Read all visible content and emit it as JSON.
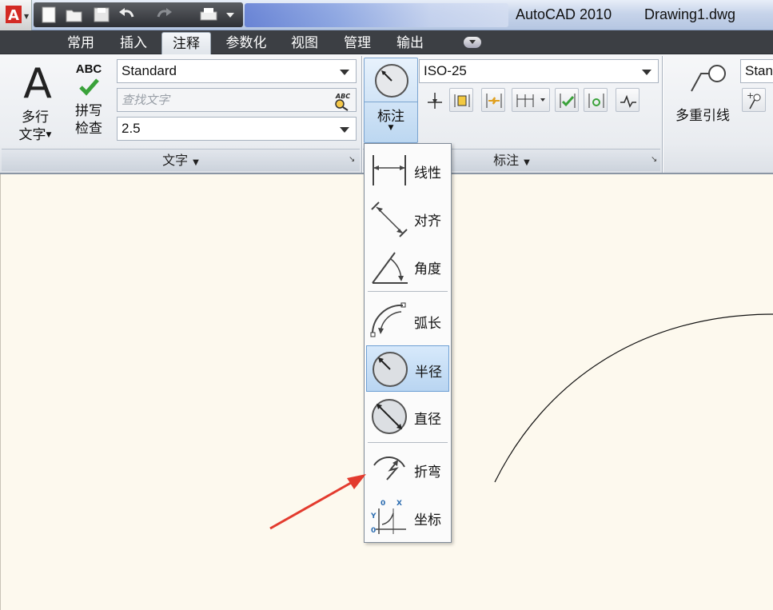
{
  "window": {
    "app_title": "AutoCAD 2010",
    "doc_title": "Drawing1.dwg"
  },
  "tabs": [
    "常用",
    "插入",
    "注释",
    "参数化",
    "视图",
    "管理",
    "输出"
  ],
  "active_tab": "注释",
  "text_panel": {
    "mtext_line1": "多行",
    "mtext_line2": "文字",
    "spell_badge": "ABC",
    "spell_line1": "拼写",
    "spell_line2": "检查",
    "style_value": "Standard",
    "search_placeholder": "查找文字",
    "height_value": "2.5",
    "footer": "文字"
  },
  "dim_panel": {
    "button_label": "标注",
    "style_value": "ISO-25",
    "footer": "标注"
  },
  "leader_panel": {
    "button_label": "多重引线",
    "style_value": "Stan"
  },
  "dropdown": {
    "items": [
      {
        "label": "线性",
        "icon": "linear-dim-icon"
      },
      {
        "label": "对齐",
        "icon": "aligned-dim-icon"
      },
      {
        "label": "角度",
        "icon": "angular-dim-icon"
      },
      {
        "label": "弧长",
        "icon": "arc-length-icon"
      },
      {
        "label": "半径",
        "icon": "radius-icon"
      },
      {
        "label": "直径",
        "icon": "diameter-icon"
      },
      {
        "label": "折弯",
        "icon": "jogged-icon"
      },
      {
        "label": "坐标",
        "icon": "ordinate-icon"
      }
    ],
    "selected": "半径"
  },
  "colors": {
    "accent_red": "#e33b2e",
    "highlight": "#bcd7f1",
    "canvas": "#fdf9ee"
  }
}
